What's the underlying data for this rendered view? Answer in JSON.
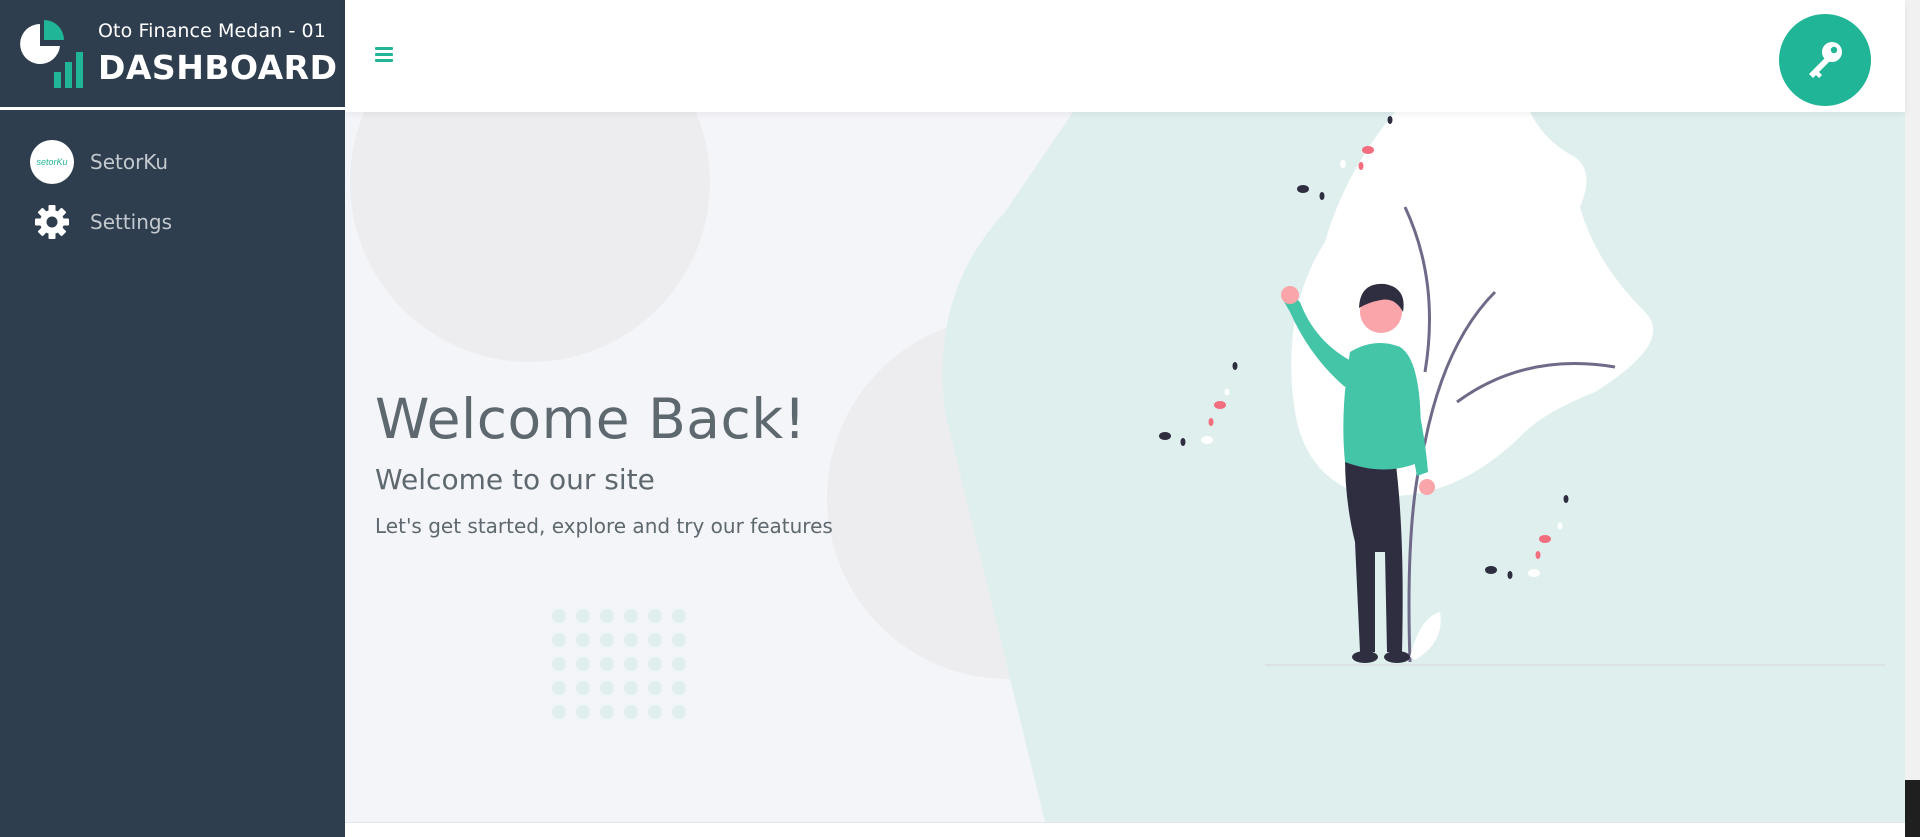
{
  "brand": {
    "subtitle": "Oto Finance Medan - 01",
    "title": "DASHBOARD",
    "icon": "pie-bar-chart-logo"
  },
  "sidebar": {
    "items": [
      {
        "label": "SetorKu",
        "icon": "setorku-logo",
        "logo_text": "setorKu"
      },
      {
        "label": "Settings",
        "icon": "gear-icon"
      }
    ]
  },
  "topbar": {
    "menu_icon": "hamburger-icon",
    "user_icon": "key-icon"
  },
  "main": {
    "title": "Welcome Back!",
    "subtitle": "Welcome to our site",
    "description": "Let's get started, explore and try our features"
  },
  "colors": {
    "sidebar": "#2f3e4e",
    "accent": "#1fb596",
    "text": "#5d686f",
    "hero_bg": "#dfefee"
  }
}
